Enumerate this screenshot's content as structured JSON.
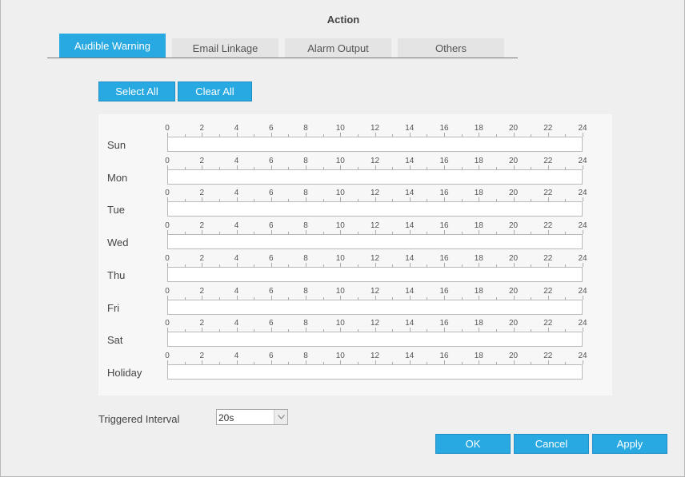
{
  "dialog": {
    "title": "Action"
  },
  "tabs": [
    {
      "label": "Audible Warning",
      "active": true
    },
    {
      "label": "Email Linkage",
      "active": false
    },
    {
      "label": "Alarm Output",
      "active": false
    },
    {
      "label": "Others",
      "active": false
    }
  ],
  "schedule": {
    "select_all_label": "Select All",
    "clear_all_label": "Clear All",
    "hour_labels": [
      "0",
      "2",
      "4",
      "6",
      "8",
      "10",
      "12",
      "14",
      "16",
      "18",
      "20",
      "22",
      "24"
    ],
    "days": [
      "Sun",
      "Mon",
      "Tue",
      "Wed",
      "Thu",
      "Fri",
      "Sat",
      "Holiday"
    ]
  },
  "triggered_interval": {
    "label": "Triggered Interval",
    "value": "20s"
  },
  "footer": {
    "ok_label": "OK",
    "cancel_label": "Cancel",
    "apply_label": "Apply"
  },
  "colors": {
    "accent": "#29a9e1",
    "background": "#efefef",
    "panel": "#f7f7f7"
  }
}
